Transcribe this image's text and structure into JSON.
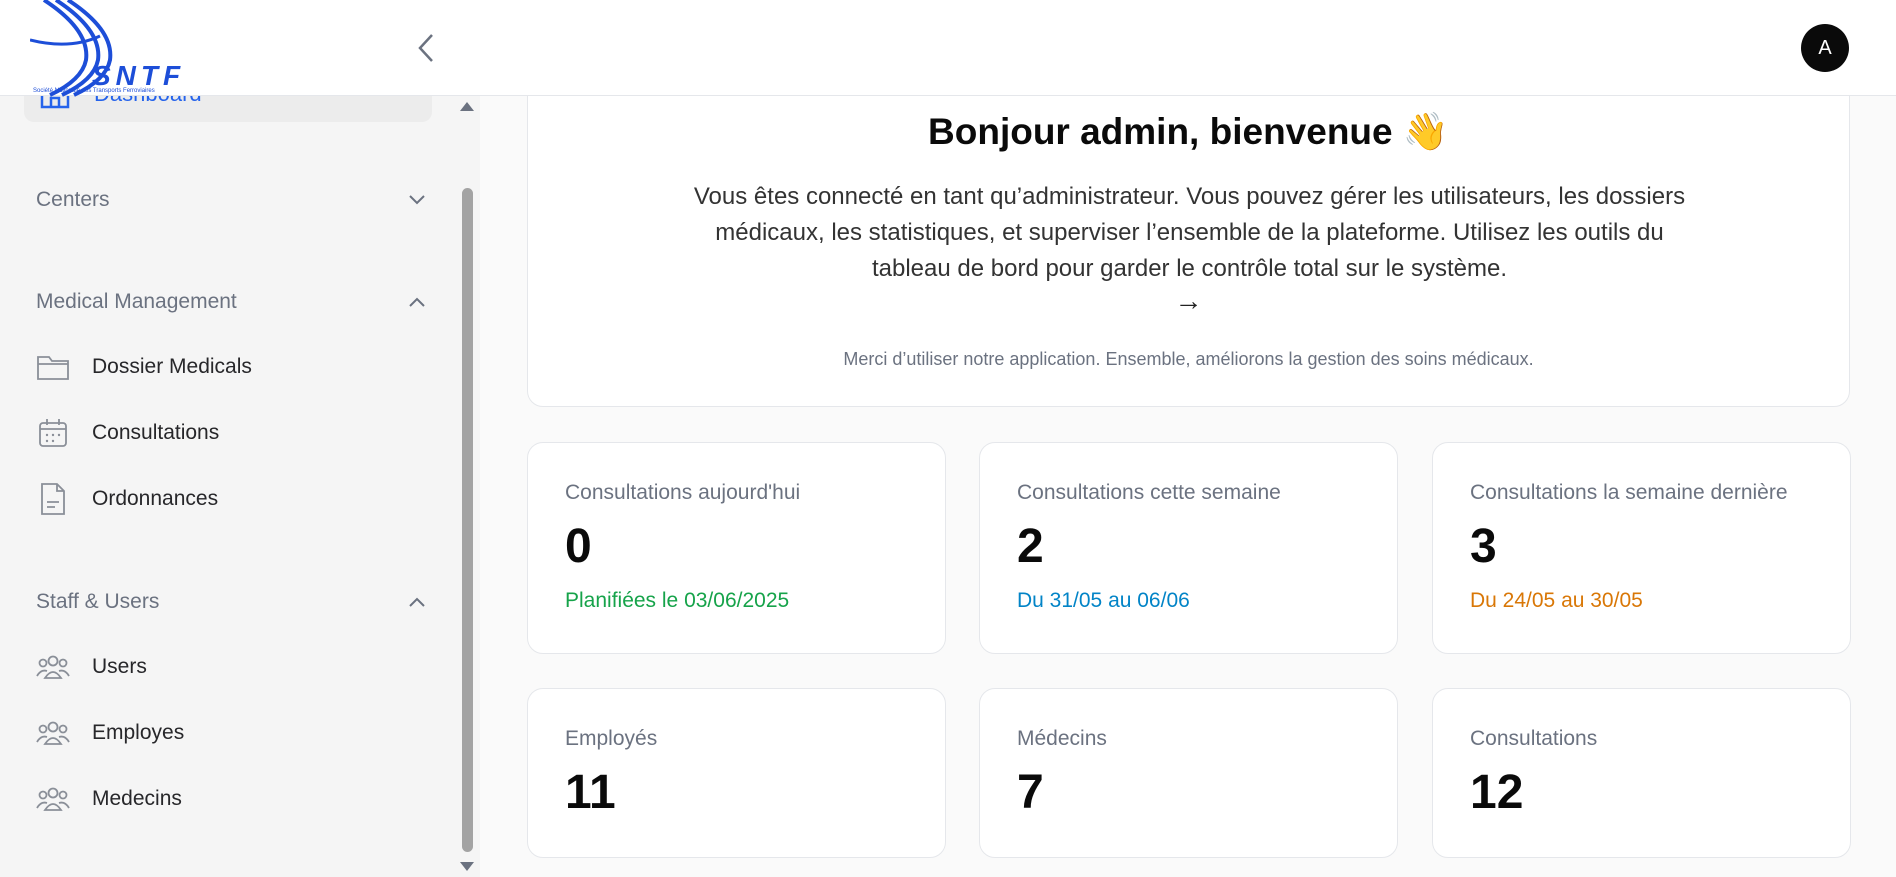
{
  "header": {
    "logo_text": "SNTF",
    "logo_subtext": "Société Nationale des Transports Ferroviaires",
    "collapse_icon": "chevron-left-icon",
    "avatar_initial": "A"
  },
  "sidebar": {
    "active_item": {
      "label": "Dashboard",
      "icon": "home-icon"
    },
    "groups": [
      {
        "label": "Centers",
        "expanded": false,
        "items": []
      },
      {
        "label": "Medical Management",
        "expanded": true,
        "items": [
          {
            "label": "Dossier Medicals",
            "icon": "folder-icon"
          },
          {
            "label": "Consultations",
            "icon": "calendar-icon"
          },
          {
            "label": "Ordonnances",
            "icon": "document-icon"
          }
        ]
      },
      {
        "label": "Staff & Users",
        "expanded": true,
        "items": [
          {
            "label": "Users",
            "icon": "users-icon"
          },
          {
            "label": "Employes",
            "icon": "users-icon"
          },
          {
            "label": "Medecins",
            "icon": "users-icon"
          }
        ]
      }
    ]
  },
  "welcome": {
    "title": "Bonjour admin, bienvenue 👋",
    "text": "Vous êtes connecté en tant qu’administrateur. Vous pouvez gérer les utilisateurs, les dossiers médicaux, les statistiques, et superviser l’ensemble de la plateforme. Utilisez les outils du tableau de bord pour garder le contrôle total sur le système.",
    "arrow": "→",
    "subtext": "Merci d’utiliser notre application. Ensemble, améliorons la gestion des soins médicaux."
  },
  "stats": [
    {
      "label": "Consultations aujourd'hui",
      "value": "0",
      "note": "Planifiées le 03/06/2025",
      "note_color": "#16a34a"
    },
    {
      "label": "Consultations cette semaine",
      "value": "2",
      "note": "Du 31/05 au 06/06",
      "note_color": "#0284c7"
    },
    {
      "label": "Consultations la semaine dernière",
      "value": "3",
      "note": "Du 24/05 au 30/05",
      "note_color": "#d97706"
    },
    {
      "label": "Employés",
      "value": "11"
    },
    {
      "label": "Médecins",
      "value": "7"
    },
    {
      "label": "Consultations",
      "value": "12"
    }
  ]
}
